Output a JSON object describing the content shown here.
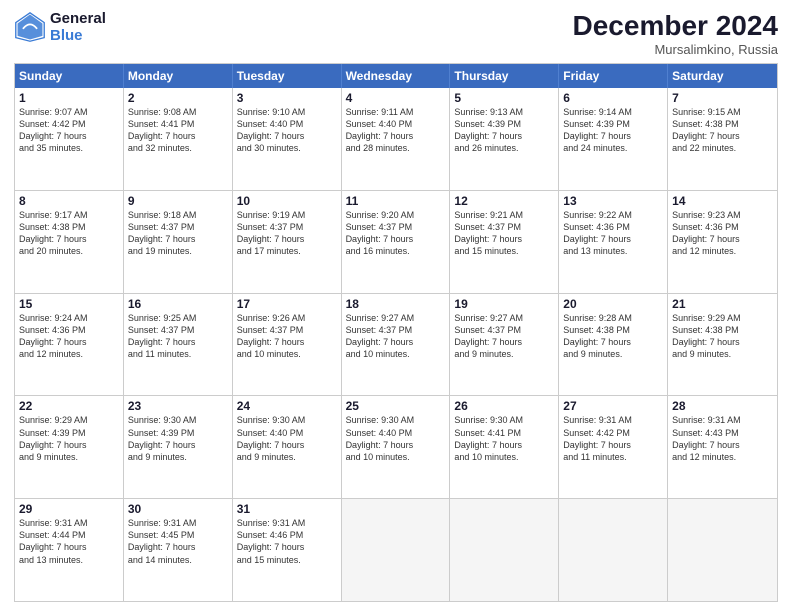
{
  "header": {
    "logo_line1": "General",
    "logo_line2": "Blue",
    "month": "December 2024",
    "location": "Mursalimkino, Russia"
  },
  "weekdays": [
    "Sunday",
    "Monday",
    "Tuesday",
    "Wednesday",
    "Thursday",
    "Friday",
    "Saturday"
  ],
  "rows": [
    [
      {
        "day": "1",
        "lines": [
          "Sunrise: 9:07 AM",
          "Sunset: 4:42 PM",
          "Daylight: 7 hours",
          "and 35 minutes."
        ]
      },
      {
        "day": "2",
        "lines": [
          "Sunrise: 9:08 AM",
          "Sunset: 4:41 PM",
          "Daylight: 7 hours",
          "and 32 minutes."
        ]
      },
      {
        "day": "3",
        "lines": [
          "Sunrise: 9:10 AM",
          "Sunset: 4:40 PM",
          "Daylight: 7 hours",
          "and 30 minutes."
        ]
      },
      {
        "day": "4",
        "lines": [
          "Sunrise: 9:11 AM",
          "Sunset: 4:40 PM",
          "Daylight: 7 hours",
          "and 28 minutes."
        ]
      },
      {
        "day": "5",
        "lines": [
          "Sunrise: 9:13 AM",
          "Sunset: 4:39 PM",
          "Daylight: 7 hours",
          "and 26 minutes."
        ]
      },
      {
        "day": "6",
        "lines": [
          "Sunrise: 9:14 AM",
          "Sunset: 4:39 PM",
          "Daylight: 7 hours",
          "and 24 minutes."
        ]
      },
      {
        "day": "7",
        "lines": [
          "Sunrise: 9:15 AM",
          "Sunset: 4:38 PM",
          "Daylight: 7 hours",
          "and 22 minutes."
        ]
      }
    ],
    [
      {
        "day": "8",
        "lines": [
          "Sunrise: 9:17 AM",
          "Sunset: 4:38 PM",
          "Daylight: 7 hours",
          "and 20 minutes."
        ]
      },
      {
        "day": "9",
        "lines": [
          "Sunrise: 9:18 AM",
          "Sunset: 4:37 PM",
          "Daylight: 7 hours",
          "and 19 minutes."
        ]
      },
      {
        "day": "10",
        "lines": [
          "Sunrise: 9:19 AM",
          "Sunset: 4:37 PM",
          "Daylight: 7 hours",
          "and 17 minutes."
        ]
      },
      {
        "day": "11",
        "lines": [
          "Sunrise: 9:20 AM",
          "Sunset: 4:37 PM",
          "Daylight: 7 hours",
          "and 16 minutes."
        ]
      },
      {
        "day": "12",
        "lines": [
          "Sunrise: 9:21 AM",
          "Sunset: 4:37 PM",
          "Daylight: 7 hours",
          "and 15 minutes."
        ]
      },
      {
        "day": "13",
        "lines": [
          "Sunrise: 9:22 AM",
          "Sunset: 4:36 PM",
          "Daylight: 7 hours",
          "and 13 minutes."
        ]
      },
      {
        "day": "14",
        "lines": [
          "Sunrise: 9:23 AM",
          "Sunset: 4:36 PM",
          "Daylight: 7 hours",
          "and 12 minutes."
        ]
      }
    ],
    [
      {
        "day": "15",
        "lines": [
          "Sunrise: 9:24 AM",
          "Sunset: 4:36 PM",
          "Daylight: 7 hours",
          "and 12 minutes."
        ]
      },
      {
        "day": "16",
        "lines": [
          "Sunrise: 9:25 AM",
          "Sunset: 4:37 PM",
          "Daylight: 7 hours",
          "and 11 minutes."
        ]
      },
      {
        "day": "17",
        "lines": [
          "Sunrise: 9:26 AM",
          "Sunset: 4:37 PM",
          "Daylight: 7 hours",
          "and 10 minutes."
        ]
      },
      {
        "day": "18",
        "lines": [
          "Sunrise: 9:27 AM",
          "Sunset: 4:37 PM",
          "Daylight: 7 hours",
          "and 10 minutes."
        ]
      },
      {
        "day": "19",
        "lines": [
          "Sunrise: 9:27 AM",
          "Sunset: 4:37 PM",
          "Daylight: 7 hours",
          "and 9 minutes."
        ]
      },
      {
        "day": "20",
        "lines": [
          "Sunrise: 9:28 AM",
          "Sunset: 4:38 PM",
          "Daylight: 7 hours",
          "and 9 minutes."
        ]
      },
      {
        "day": "21",
        "lines": [
          "Sunrise: 9:29 AM",
          "Sunset: 4:38 PM",
          "Daylight: 7 hours",
          "and 9 minutes."
        ]
      }
    ],
    [
      {
        "day": "22",
        "lines": [
          "Sunrise: 9:29 AM",
          "Sunset: 4:39 PM",
          "Daylight: 7 hours",
          "and 9 minutes."
        ]
      },
      {
        "day": "23",
        "lines": [
          "Sunrise: 9:30 AM",
          "Sunset: 4:39 PM",
          "Daylight: 7 hours",
          "and 9 minutes."
        ]
      },
      {
        "day": "24",
        "lines": [
          "Sunrise: 9:30 AM",
          "Sunset: 4:40 PM",
          "Daylight: 7 hours",
          "and 9 minutes."
        ]
      },
      {
        "day": "25",
        "lines": [
          "Sunrise: 9:30 AM",
          "Sunset: 4:40 PM",
          "Daylight: 7 hours",
          "and 10 minutes."
        ]
      },
      {
        "day": "26",
        "lines": [
          "Sunrise: 9:30 AM",
          "Sunset: 4:41 PM",
          "Daylight: 7 hours",
          "and 10 minutes."
        ]
      },
      {
        "day": "27",
        "lines": [
          "Sunrise: 9:31 AM",
          "Sunset: 4:42 PM",
          "Daylight: 7 hours",
          "and 11 minutes."
        ]
      },
      {
        "day": "28",
        "lines": [
          "Sunrise: 9:31 AM",
          "Sunset: 4:43 PM",
          "Daylight: 7 hours",
          "and 12 minutes."
        ]
      }
    ],
    [
      {
        "day": "29",
        "lines": [
          "Sunrise: 9:31 AM",
          "Sunset: 4:44 PM",
          "Daylight: 7 hours",
          "and 13 minutes."
        ]
      },
      {
        "day": "30",
        "lines": [
          "Sunrise: 9:31 AM",
          "Sunset: 4:45 PM",
          "Daylight: 7 hours",
          "and 14 minutes."
        ]
      },
      {
        "day": "31",
        "lines": [
          "Sunrise: 9:31 AM",
          "Sunset: 4:46 PM",
          "Daylight: 7 hours",
          "and 15 minutes."
        ]
      },
      {
        "day": "",
        "lines": []
      },
      {
        "day": "",
        "lines": []
      },
      {
        "day": "",
        "lines": []
      },
      {
        "day": "",
        "lines": []
      }
    ]
  ]
}
